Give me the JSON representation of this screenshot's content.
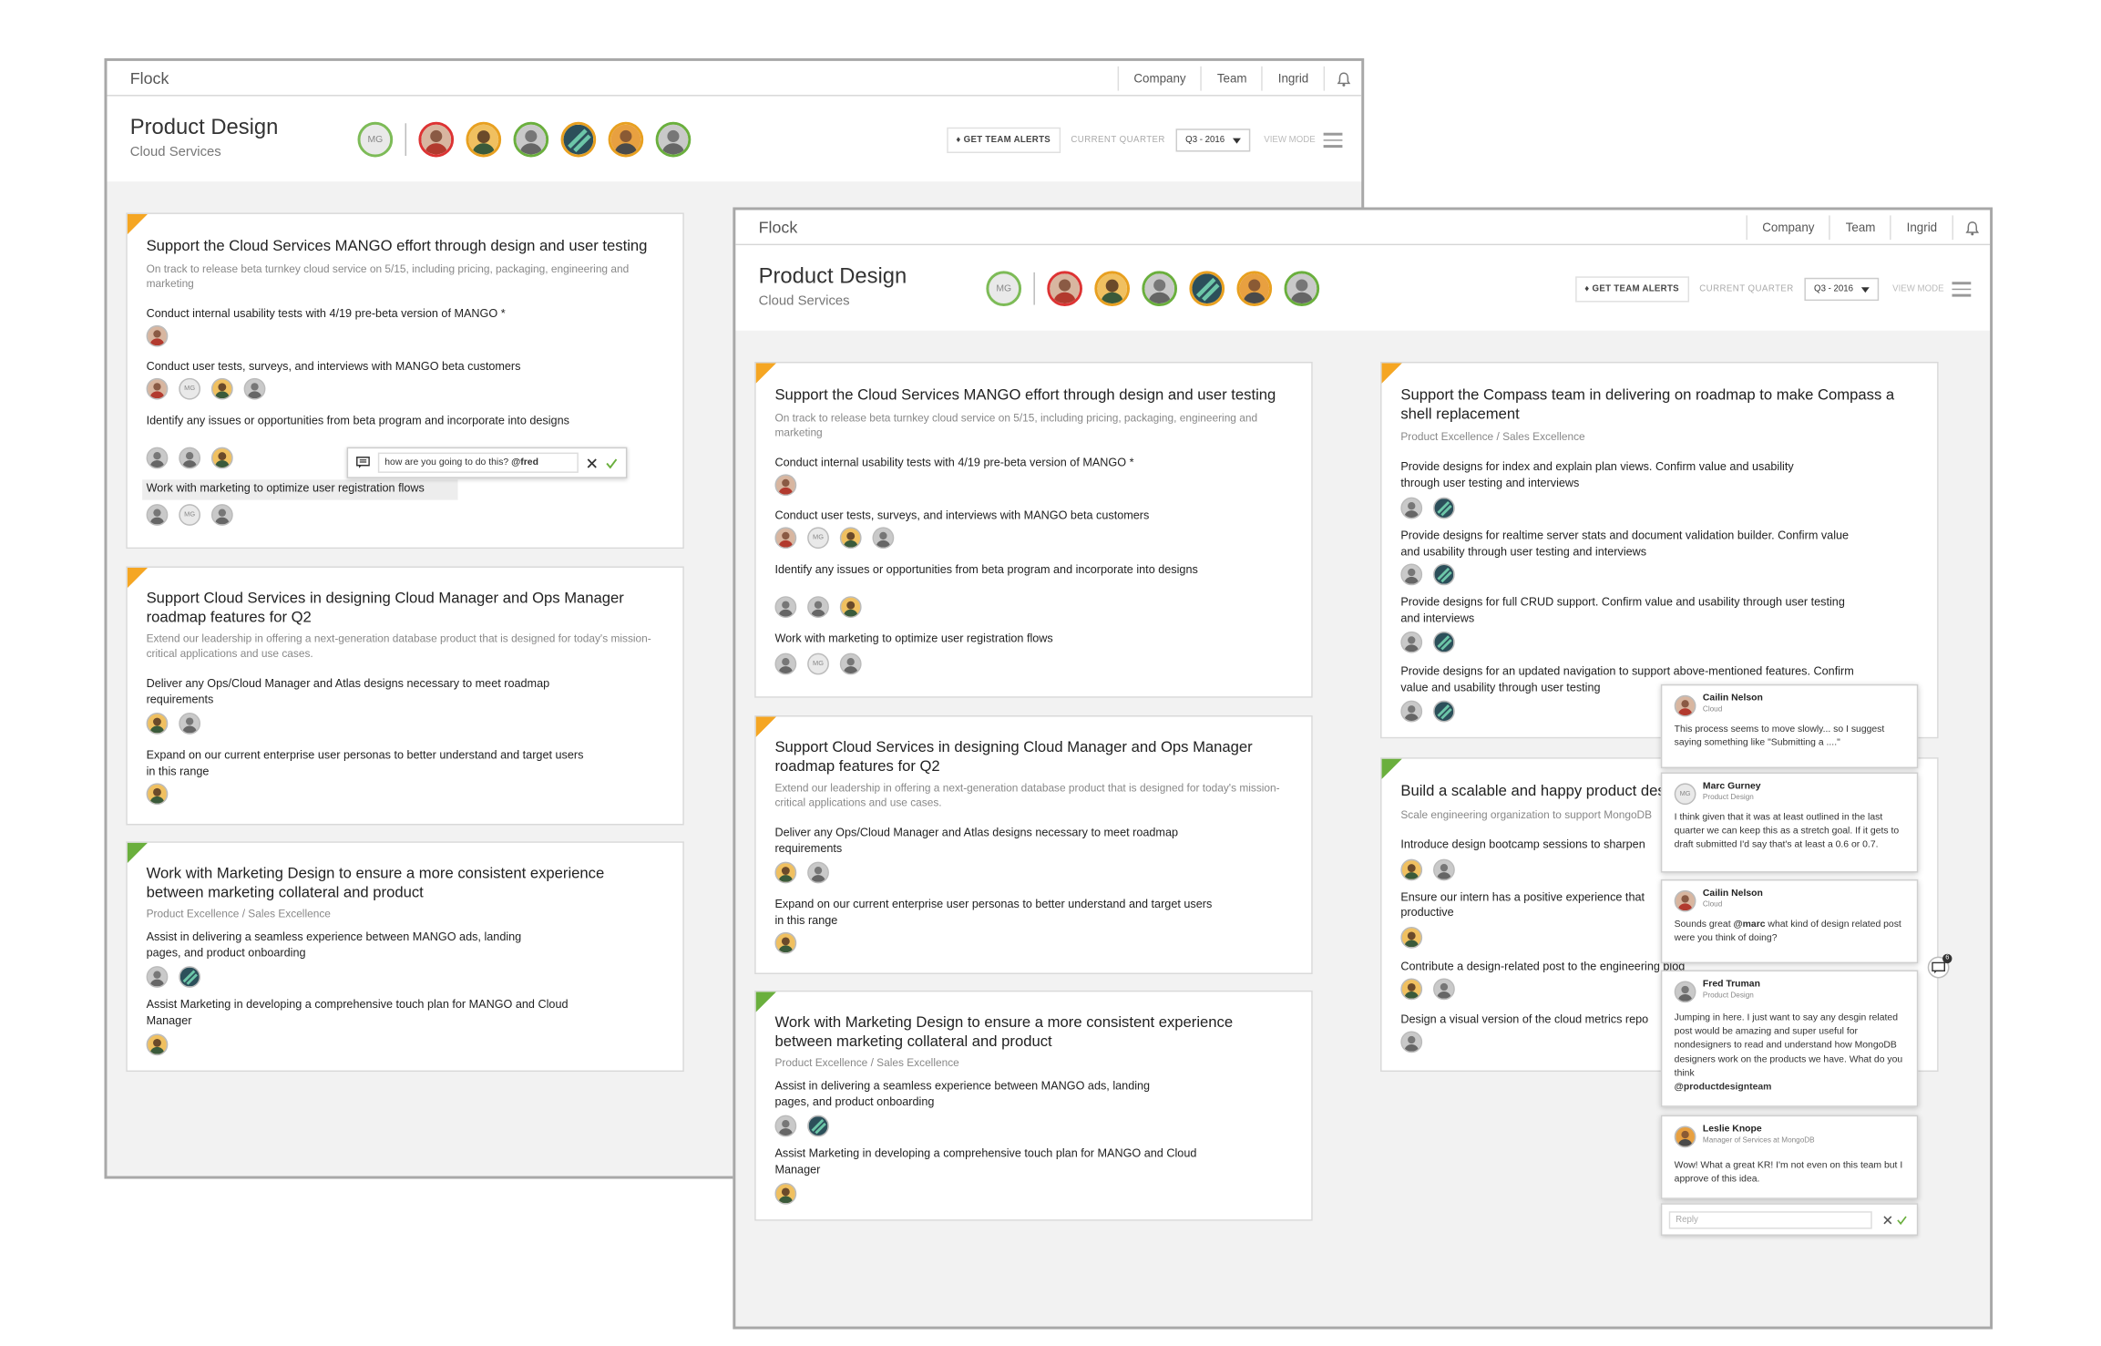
{
  "app": {
    "brand": "Flock",
    "nav": [
      "Company",
      "Team",
      "Ingrid"
    ]
  },
  "header": {
    "title": "Product Design",
    "subtitle": "Cloud Services",
    "alerts_label": "GET TEAM ALERTS",
    "quarter_label": "CURRENT QUARTER",
    "quarter_value": "Q3 - 2016",
    "view_mode_label": "VIEW MODE",
    "team_initials": "MG"
  },
  "cards": [
    {
      "title": "Support the Cloud Services MANGO effort through design and user testing",
      "subtitle": "On track to release beta turnkey cloud service on 5/15, including pricing, packaging, engineering and marketing",
      "krs": [
        "Conduct internal usability tests with 4/19 pre-beta version of MANGO *",
        "Conduct user tests, surveys, and interviews with MANGO beta customers",
        "Identify any issues or opportunities from beta program and incorporate into designs",
        "Work with marketing to optimize user registration flows"
      ]
    },
    {
      "title": "Support Cloud Services in designing Cloud Manager and Ops Manager roadmap features for Q2",
      "subtitle": "Extend our leadership in offering a next-generation database product that is designed for today's mission-critical applications and use cases.",
      "krs": [
        "Deliver any Ops/Cloud Manager and Atlas designs necessary to meet roadmap requirements",
        "Expand on our current enterprise user personas to better understand and target users in this range"
      ]
    },
    {
      "title": "Work with Marketing Design to ensure a more consistent experience between marketing collateral and product",
      "subtitle": "Product Excellence / Sales Excellence",
      "krs": [
        "Assist in delivering a seamless experience between MANGO ads, landing pages, and product onboarding",
        "Assist Marketing in developing a comprehensive touch plan for MANGO and Cloud Manager"
      ]
    },
    {
      "title": "Support the Compass team in delivering on roadmap to make Compass a shell replacement",
      "subtitle": "Product Excellence / Sales Excellence",
      "krs": [
        "Provide designs for index and explain plan views. Confirm value and usability through user testing and interviews",
        "Provide designs for realtime server stats and document validation builder. Confirm value and usability through user testing and interviews",
        "Provide designs for full CRUD support. Confirm value and usability through user testing and interviews",
        "Provide designs for an updated navigation to support above-mentioned features. Confirm value and usability through user testing"
      ]
    },
    {
      "title": "Build a scalable and happy product des",
      "subtitle": "Scale engineering organization to support MongoDB",
      "krs": [
        "Introduce design bootcamp sessions to sharpen",
        "Ensure our intern has a positive experience that",
        "productive",
        "Contribute a design-related post to the engineering blog",
        "Design a visual version of the cloud metrics repo"
      ]
    }
  ],
  "inline_comment": {
    "value": "how are you going to do this? @fred"
  },
  "comments": [
    {
      "name": "Cailin Nelson",
      "role": "Cloud",
      "text": "This process seems to move slowly... so I suggest saying something like \"Submitting a ....\""
    },
    {
      "name": "Marc Gurney",
      "role": "Product Design",
      "initials": "MG",
      "text": "I think given that it was at least outlined in the last quarter we can keep this as a stretch goal. If it gets to draft submitted I'd say that's at least a 0.6 or 0.7."
    },
    {
      "name": "Cailin Nelson",
      "role": "Cloud",
      "text_pre": "Sounds great ",
      "mention": "@marc",
      "text_post": " what kind of design related post were you think of doing?"
    },
    {
      "name": "Fred Truman",
      "role": "Product Design",
      "text": "Jumping in here. I just want to say any desgin related post would be amazing and super useful for nondesigners to read and understand how MongoDB designers work on the products we have. What do you think",
      "mention": "@productdesignteam"
    },
    {
      "name": "Leslie Knope",
      "role": "Manager of Services at MongoDB",
      "text": "Wow! What a great KR! I'm not even on this team but I approve of this idea."
    }
  ],
  "reply": {
    "placeholder": "Reply"
  },
  "chat_count": "6",
  "colors": {
    "accent_orange": "#f5a623",
    "accent_green": "#6aaf3d",
    "background": "#f2f2f2"
  }
}
